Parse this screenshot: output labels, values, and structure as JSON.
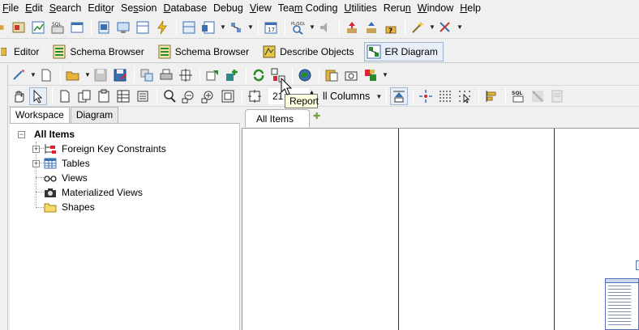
{
  "menu": {
    "items": [
      {
        "pre": "",
        "u": "F",
        "post": "ile"
      },
      {
        "pre": "",
        "u": "E",
        "post": "dit"
      },
      {
        "pre": "",
        "u": "S",
        "post": "earch"
      },
      {
        "pre": "Edit",
        "u": "o",
        "post": "r"
      },
      {
        "pre": "Se",
        "u": "s",
        "post": "sion"
      },
      {
        "pre": "",
        "u": "D",
        "post": "atabase"
      },
      {
        "pre": "Debu",
        "u": "g",
        "post": ""
      },
      {
        "pre": "",
        "u": "V",
        "post": "iew"
      },
      {
        "pre": "Tea",
        "u": "m",
        "post": " Coding"
      },
      {
        "pre": "",
        "u": "U",
        "post": "tilities"
      },
      {
        "pre": "Reru",
        "u": "n",
        "post": ""
      },
      {
        "pre": "",
        "u": "W",
        "post": "indow"
      },
      {
        "pre": "",
        "u": "H",
        "post": "elp"
      }
    ]
  },
  "window_tabs": [
    {
      "label": "Editor",
      "icon": "editor-icon"
    },
    {
      "label": "Schema Browser",
      "icon": "schema-browser-icon"
    },
    {
      "label": "Schema Browser",
      "icon": "schema-browser-icon"
    },
    {
      "label": "Describe Objects",
      "icon": "describe-objects-icon"
    },
    {
      "label": "ER Diagram",
      "icon": "er-diagram-icon",
      "active": true
    }
  ],
  "toolbar": {
    "zoom_value": "21",
    "columns_combo": "All Columns",
    "columns_combo_visible": "ll Columns",
    "tooltip": "Report"
  },
  "panel_tabs": [
    {
      "label": "Workspace",
      "active": true
    },
    {
      "label": "Diagram",
      "active": false
    }
  ],
  "tree": {
    "root": "All Items",
    "children": [
      {
        "label": "Foreign Key Constraints",
        "icon": "foreign-key-icon",
        "expandable": true
      },
      {
        "label": "Tables",
        "icon": "table-icon",
        "expandable": true
      },
      {
        "label": "Views",
        "icon": "views-glasses-icon",
        "expandable": false
      },
      {
        "label": "Materialized Views",
        "icon": "camera-icon",
        "expandable": false
      },
      {
        "label": "Shapes",
        "icon": "folder-icon",
        "expandable": false
      }
    ]
  },
  "document_tab": "All Items",
  "colors": {
    "menubar_bg": "#f0f0f0",
    "tooltip_bg": "#ffffe1",
    "canvas_bg": "#ffffff",
    "accent_table_border": "#5470b8"
  }
}
